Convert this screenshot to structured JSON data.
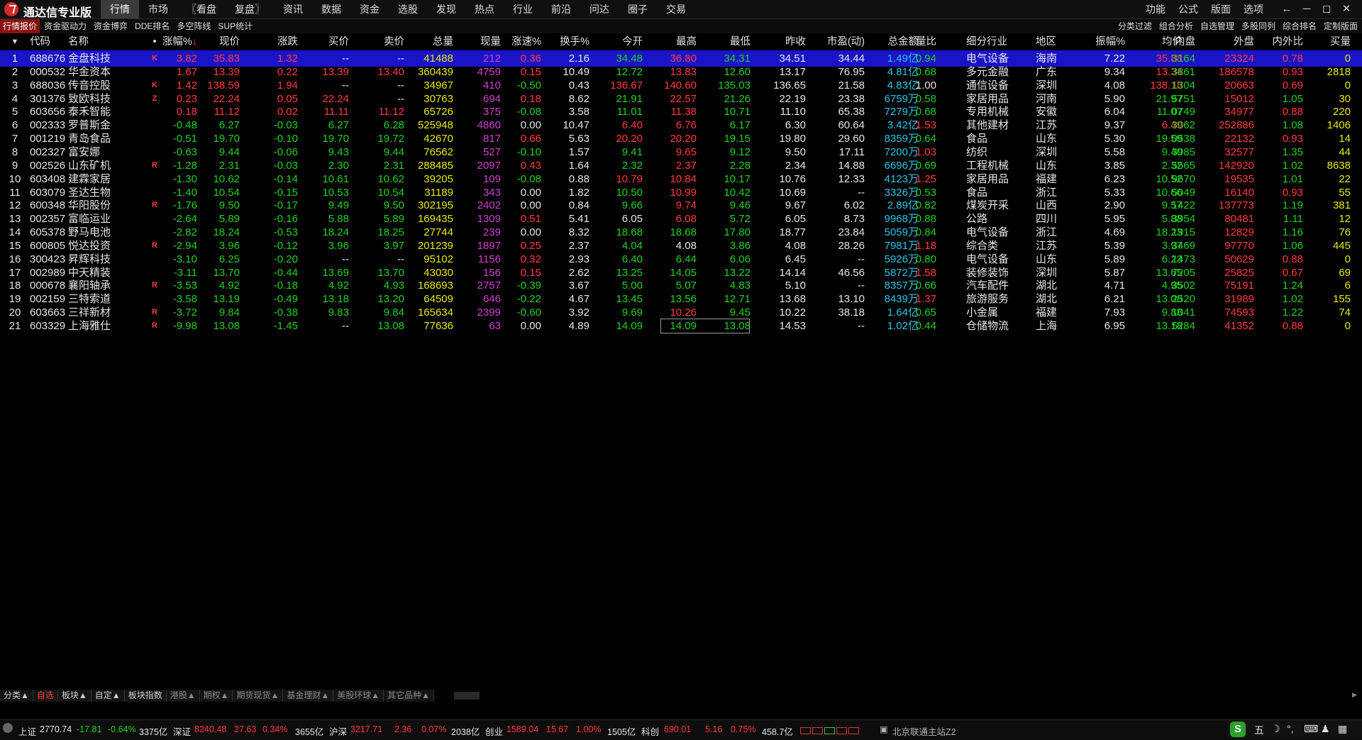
{
  "app": {
    "title": "通达信专业版"
  },
  "menu": [
    "行情",
    "市场",
    "〖看盘",
    "复盘〗",
    "资讯",
    "数据",
    "资金",
    "选股",
    "发现",
    "热点",
    "行业",
    "前沿",
    "问达",
    "圈子",
    "交易"
  ],
  "menu_active": 0,
  "right_menu": [
    "功能",
    "公式",
    "版面",
    "选项"
  ],
  "window_controls": [
    "←",
    "─",
    "◻",
    "✕"
  ],
  "sub_toolbar_left": [
    "行情报价",
    "资金驱动力",
    "资金博弈",
    "DDE排名",
    "多空阵线",
    "SUP统计"
  ],
  "sub_toolbar_right": [
    "分类过滤",
    "组合分析",
    "自选管理",
    "多股同列",
    "综合排名",
    "定制版面"
  ],
  "headers": [
    "",
    "代码",
    "名称",
    "•",
    "涨幅%↓",
    "现价",
    "涨跌",
    "买价",
    "卖价",
    "总量",
    "现量",
    "涨速%",
    "换手%",
    "今开",
    "最高",
    "最低",
    "昨收",
    "市盈(动)",
    "总金额",
    "量比",
    "细分行业",
    "地区",
    "振幅%",
    "均价",
    "内盘",
    "外盘",
    "内外比",
    "买量"
  ],
  "sort_indicator": "▼",
  "rows": [
    [
      "1",
      "688676",
      "金盘科技",
      "K",
      "3.82",
      "35.83",
      "1.32",
      "--",
      "--",
      "41488",
      "212",
      "0.36",
      "2.16",
      "34.48",
      "36.80",
      "34.31",
      "34.51",
      "34.44",
      "1.49亿",
      "0.94",
      "电气设备",
      "海南",
      "7.22",
      "35.88",
      "3164",
      "23324",
      "0.78",
      "0"
    ],
    [
      "2",
      "000532",
      "华金资本",
      "",
      "1.67",
      "13.39",
      "0.22",
      "13.39",
      "13.40",
      "360439",
      "4759",
      "0.15",
      "10.49",
      "12.72",
      "13.83",
      "12.60",
      "13.17",
      "76.95",
      "4.81亿",
      "0.68",
      "多元金融",
      "广东",
      "9.34",
      "13.34",
      "3861",
      "186578",
      "0.93",
      "2818"
    ],
    [
      "3",
      "688036",
      "传音控股",
      "K",
      "1.42",
      "138.59",
      "1.94",
      "--",
      "--",
      "34967",
      "410",
      "-0.50",
      "0.43",
      "136.67",
      "140.60",
      "135.03",
      "136.65",
      "21.58",
      "4.83亿",
      "1.00",
      "通信设备",
      "深圳",
      "4.08",
      "138.18",
      "1304",
      "20663",
      "0.69",
      "0"
    ],
    [
      "4",
      "301376",
      "致欧科技",
      "Z",
      "0.23",
      "22.24",
      "0.05",
      "22.24",
      "--",
      "30763",
      "694",
      "0.18",
      "8.62",
      "21.91",
      "22.57",
      "21.26",
      "22.19",
      "23.38",
      "6759万",
      "0.58",
      "家居用品",
      "河南",
      "5.90",
      "21.97",
      "5751",
      "15012",
      "1.05",
      "30"
    ],
    [
      "5",
      "603656",
      "泰禾智能",
      "",
      "0.18",
      "11.12",
      "0.02",
      "11.11",
      "11.12",
      "65726",
      "375",
      "-0.08",
      "3.58",
      "11.01",
      "11.38",
      "10.71",
      "11.10",
      "65.38",
      "7279万",
      "0.68",
      "专用机械",
      "安徽",
      "6.04",
      "11.07",
      "0749",
      "34977",
      "0.88",
      "220"
    ],
    [
      "6",
      "002333",
      "罗普斯金",
      "",
      "-0.48",
      "6.27",
      "-0.03",
      "6.27",
      "6.28",
      "525948",
      "4860",
      "0.00",
      "10.47",
      "6.40",
      "6.76",
      "6.17",
      "6.30",
      "60.64",
      "3.42亿",
      "1.53",
      "其他建材",
      "江苏",
      "9.37",
      "6.49",
      "3062",
      "252886",
      "1.08",
      "1406"
    ],
    [
      "7",
      "001219",
      "青岛食品",
      "",
      "-0.51",
      "19.70",
      "-0.10",
      "19.70",
      "19.72",
      "42670",
      "817",
      "0.66",
      "5.63",
      "20.20",
      "20.20",
      "19.15",
      "19.80",
      "29.60",
      "8359万",
      "0.64",
      "食品",
      "山东",
      "5.30",
      "19.59",
      "0538",
      "22132",
      "0.93",
      "14"
    ],
    [
      "8",
      "002327",
      "富安娜",
      "",
      "-0.63",
      "9.44",
      "-0.06",
      "9.43",
      "9.44",
      "76562",
      "527",
      "-0.10",
      "1.57",
      "9.41",
      "9.65",
      "9.12",
      "9.50",
      "17.11",
      "7200万",
      "1.03",
      "纺织",
      "深圳",
      "5.58",
      "9.40",
      "3985",
      "32577",
      "1.35",
      "44"
    ],
    [
      "9",
      "002526",
      "山东矿机",
      "R",
      "-1.28",
      "2.31",
      "-0.03",
      "2.30",
      "2.31",
      "288485",
      "2097",
      "0.43",
      "1.64",
      "2.32",
      "2.37",
      "2.28",
      "2.34",
      "14.88",
      "6696万",
      "0.69",
      "工程机械",
      "山东",
      "3.85",
      "2.32",
      "5565",
      "142920",
      "1.02",
      "8638"
    ],
    [
      "10",
      "603408",
      "建霖家居",
      "",
      "-1.30",
      "10.62",
      "-0.14",
      "10.61",
      "10.62",
      "39205",
      "109",
      "-0.08",
      "0.88",
      "10.79",
      "10.84",
      "10.17",
      "10.76",
      "12.33",
      "4123万",
      "1.25",
      "家居用品",
      "福建",
      "6.23",
      "10.52",
      "9670",
      "19535",
      "1.01",
      "22"
    ],
    [
      "11",
      "603079",
      "圣达生物",
      "",
      "-1.40",
      "10.54",
      "-0.15",
      "10.53",
      "10.54",
      "31189",
      "343",
      "0.00",
      "1.82",
      "10.50",
      "10.99",
      "10.42",
      "10.69",
      "--",
      "3326万",
      "0.53",
      "食品",
      "浙江",
      "5.33",
      "10.66",
      "5049",
      "16140",
      "0.93",
      "55"
    ],
    [
      "12",
      "600348",
      "华阳股份",
      "R",
      "-1.76",
      "9.50",
      "-0.17",
      "9.49",
      "9.50",
      "302195",
      "2402",
      "0.00",
      "0.84",
      "9.66",
      "9.74",
      "9.46",
      "9.67",
      "6.02",
      "2.89亿",
      "0.82",
      "煤炭开采",
      "山西",
      "2.90",
      "9.57",
      "1422",
      "137773",
      "1.19",
      "381"
    ],
    [
      "13",
      "002357",
      "富临运业",
      "",
      "-2.64",
      "5.89",
      "-0.16",
      "5.88",
      "5.89",
      "169435",
      "1309",
      "0.51",
      "5.41",
      "6.05",
      "6.08",
      "5.72",
      "6.05",
      "8.73",
      "9968万",
      "0.88",
      "公路",
      "四川",
      "5.95",
      "5.88",
      "3954",
      "80481",
      "1.11",
      "12"
    ],
    [
      "14",
      "605378",
      "野马电池",
      "",
      "-2.82",
      "18.24",
      "-0.53",
      "18.24",
      "18.25",
      "27744",
      "239",
      "0.00",
      "8.32",
      "18.68",
      "18.68",
      "17.80",
      "18.77",
      "23.84",
      "5059万",
      "0.84",
      "电气设备",
      "浙江",
      "4.69",
      "18.23",
      "1915",
      "12829",
      "1.16",
      "76"
    ],
    [
      "15",
      "600805",
      "悦达投资",
      "R",
      "-2.94",
      "3.96",
      "-0.12",
      "3.96",
      "3.97",
      "201239",
      "1897",
      "0.25",
      "2.37",
      "4.04",
      "4.08",
      "3.86",
      "4.08",
      "28.26",
      "7981万",
      "1.18",
      "综合类",
      "江苏",
      "5.39",
      "3.97",
      "3469",
      "97770",
      "1.06",
      "445"
    ],
    [
      "16",
      "300423",
      "昇辉科技",
      "",
      "-3.10",
      "6.25",
      "-0.20",
      "--",
      "--",
      "95102",
      "1156",
      "0.32",
      "2.93",
      "6.40",
      "6.44",
      "6.06",
      "6.45",
      "--",
      "5926万",
      "0.80",
      "电气设备",
      "山东",
      "5.89",
      "6.23",
      "1473",
      "50629",
      "0.88",
      "0"
    ],
    [
      "17",
      "002989",
      "中天精装",
      "",
      "-3.11",
      "13.70",
      "-0.44",
      "13.69",
      "13.70",
      "43030",
      "156",
      "0.15",
      "2.62",
      "13.25",
      "14.05",
      "13.22",
      "14.14",
      "46.56",
      "5872万",
      "1.58",
      "装修装饰",
      "深圳",
      "5.87",
      "13.65",
      "7205",
      "25825",
      "0.67",
      "69"
    ],
    [
      "18",
      "000678",
      "襄阳轴承",
      "R",
      "-3.53",
      "4.92",
      "-0.18",
      "4.92",
      "4.93",
      "168693",
      "2757",
      "-0.39",
      "3.67",
      "5.00",
      "5.07",
      "4.83",
      "5.10",
      "--",
      "8357万",
      "0.66",
      "汽车配件",
      "湖北",
      "4.71",
      "4.95",
      "3502",
      "75191",
      "1.24",
      "6"
    ],
    [
      "19",
      "002159",
      "三特索道",
      "",
      "-3.58",
      "13.19",
      "-0.49",
      "13.18",
      "13.20",
      "64509",
      "646",
      "-0.22",
      "4.67",
      "13.45",
      "13.56",
      "12.71",
      "13.68",
      "13.10",
      "8439万",
      "1.37",
      "旅游服务",
      "湖北",
      "6.21",
      "13.08",
      "2520",
      "31989",
      "1.02",
      "155"
    ],
    [
      "20",
      "603663",
      "三祥新材",
      "R",
      "-3.72",
      "9.84",
      "-0.38",
      "9.83",
      "9.84",
      "165634",
      "2399",
      "-0.60",
      "3.92",
      "9.69",
      "10.26",
      "9.45",
      "10.22",
      "38.18",
      "1.64亿",
      "0.65",
      "小金属",
      "福建",
      "7.93",
      "9.88",
      "1041",
      "74593",
      "1.22",
      "74"
    ],
    [
      "21",
      "603329",
      "上海雅仕",
      "R",
      "-9.98",
      "13.08",
      "-1.45",
      "--",
      "13.08",
      "77636",
      "63",
      "0.00",
      "4.89",
      "14.09",
      "14.09",
      "13.08",
      "14.53",
      "--",
      "1.02亿",
      "0.44",
      "仓储物流",
      "上海",
      "6.95",
      "13.18",
      "5284",
      "41352",
      "0.88",
      "0"
    ]
  ],
  "bottom_tabs": [
    "分类▲",
    "自选",
    "板块▲",
    "自定▲",
    "板块指数",
    "港股▲",
    "期权▲",
    "期货现货▲",
    "基金理财▲",
    "美股环球▲",
    "其它品种▲"
  ],
  "bottom_tab_active": 1,
  "status": {
    "sh_label": "上证",
    "sh_val": "2770.74",
    "sh_chg": "-17.81",
    "sh_pct": "-0.64%",
    "sh_amt": "3375亿",
    "sz_label": "深证",
    "sz_val": "8240.48",
    "sz_chg": "27.63",
    "sz_pct": "0.34%",
    "sz_amt": "3655亿",
    "hs_label": "沪深",
    "hs_val": "3217.71",
    "hs_chg": "2.36",
    "hs_pct": "0.07%",
    "hs_amt": "2038亿",
    "cy_label": "创业",
    "cy_val": "1589.04",
    "cy_chg": "15.67",
    "cy_pct": "1.00%",
    "cy_amt": "1505亿",
    "kc_label": "科创",
    "kc_val": "690.01",
    "kc_chg": "5.16",
    "kc_pct": "0.75%",
    "kc_amt": "458.7亿",
    "server": "北京联通主站Z2"
  },
  "ime": {
    "logo": "S",
    "mode": "五",
    "icons": [
      "☽",
      "°,",
      "⌨",
      "♟",
      "▦"
    ]
  },
  "colors": {
    "up": "#ff3b3b",
    "down": "#1fd21f",
    "select": "#1a14c8",
    "volume": "#e8e800",
    "amount": "#27c7e8",
    "nowvol": "#d040d0"
  }
}
